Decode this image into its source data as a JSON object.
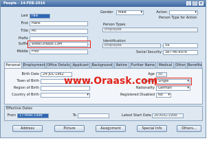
{
  "window": {
    "title": "People - 14-FEB-2014",
    "min": "_",
    "max": "□",
    "close": "×"
  },
  "person": {
    "last_label": "Last",
    "last_value": "Fasi",
    "first_label": "First",
    "first_value": "Hans",
    "title_label": "Title",
    "title_value": "Mr.",
    "prefix_label": "Prefix",
    "prefix_value": "",
    "suffix_label": "Suffix",
    "suffix_value": "Www.Oraask.CoM",
    "middle_label": "Middle",
    "middle_value": "Fritz",
    "gender_label": "Gender",
    "gender_value": "Male",
    "action_label": "Action",
    "action_value": "",
    "person_type_for_action_label": "Person Type for Action",
    "person_types_label": "Person Types",
    "person_types_value": "Employee",
    "identification_label": "Identification",
    "identification_type_value": "Employee",
    "identification_number_value": "59",
    "social_security_label": "Social Security",
    "social_security_value": "387-46-6976"
  },
  "tabs": [
    "Personal",
    "Employment",
    "Office Details",
    "Applicant",
    "Background",
    "Rehire",
    "Further Name",
    "Medical",
    "Other",
    "Benefits"
  ],
  "personal": {
    "birth_date_label": "Birth Date",
    "birth_date_value": "24-JUL-1962",
    "town_of_birth_label": "Town of Birth",
    "town_of_birth_value": "",
    "region_of_birth_label": "Region of Birth",
    "region_of_birth_value": "",
    "country_of_birth_label": "Country of Birth",
    "country_of_birth_value": "",
    "age_label": "Age",
    "age_value": "50",
    "status_label": "Status",
    "status_value": "Single",
    "nationality_label": "Nationality",
    "nationality_value": "German",
    "registered_disabled_label": "Registered Disabled",
    "registered_disabled_value": "No"
  },
  "effective_dates": {
    "heading": "Effective Dates",
    "from_label": "From",
    "from_value": "17-MAR-1998",
    "to_label": "To",
    "to_value": "",
    "latest_start_label": "Latest Start Date",
    "latest_start_value": "26-AUG-1998"
  },
  "watermark": "www.Oraask.com",
  "buttons": [
    "Address",
    "Picture",
    "Assignment",
    "Special Info",
    "Others..."
  ]
}
